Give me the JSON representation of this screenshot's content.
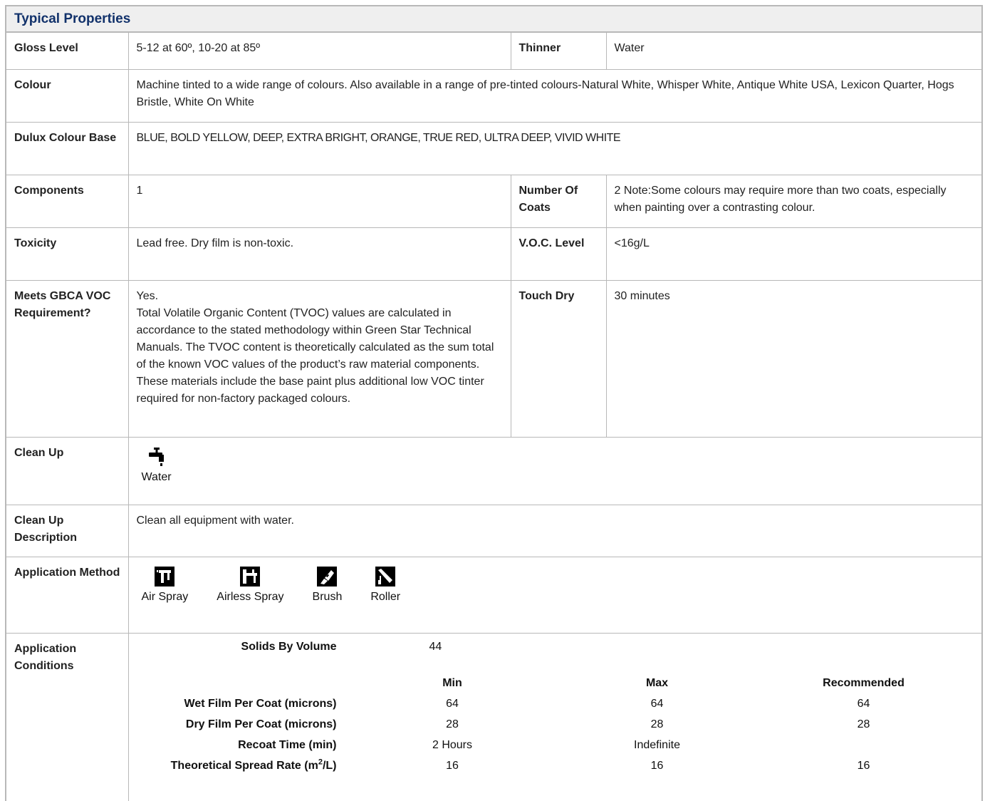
{
  "header": {
    "title": "Typical Properties"
  },
  "rows": {
    "gloss": {
      "label": "Gloss Level",
      "value": "5-12 at 60º, 10-20 at 85º"
    },
    "thinner": {
      "label": "Thinner",
      "value": "Water"
    },
    "colour": {
      "label": "Colour",
      "value": "Machine tinted to a wide range of colours. Also available in a range of pre-tinted colours-Natural White, Whisper White, Antique White USA, Lexicon Quarter, Hogs Bristle, White On White"
    },
    "base": {
      "label": "Dulux Colour Base",
      "value": "BLUE, BOLD YELLOW, DEEP, EXTRA BRIGHT, ORANGE, TRUE RED, ULTRA DEEP, VIVID WHITE"
    },
    "components": {
      "label": "Components",
      "value": "1"
    },
    "coats": {
      "label": "Number Of Coats",
      "value": "2 Note:Some colours may require more than two coats, especially when painting over a contrasting colour."
    },
    "toxicity": {
      "label": "Toxicity",
      "value": "Lead free. Dry film is non-toxic."
    },
    "voc": {
      "label": "V.O.C. Level",
      "value": "<16g/L"
    },
    "gbca": {
      "label": "Meets GBCA VOC Requirement?",
      "value_line1": "Yes.",
      "value_line2": "Total Volatile Organic Content (TVOC) values are calculated in accordance to the stated methodology within Green Star Technical Manuals. The TVOC content is theoretically calculated as the sum total of the known VOC values of the product’s raw material components. These materials include the base paint plus additional low VOC tinter required for non-factory packaged colours."
    },
    "touch": {
      "label": "Touch Dry",
      "value": "30 minutes"
    },
    "cleanup": {
      "label": "Clean Up",
      "items": [
        {
          "icon": "tap-icon",
          "label": "Water"
        }
      ]
    },
    "cleanup_desc": {
      "label": "Clean Up Description",
      "value": "Clean all equipment with water."
    },
    "method": {
      "label": "Application Method",
      "items": [
        {
          "icon": "air-spray-icon",
          "label": "Air Spray"
        },
        {
          "icon": "airless-spray-icon",
          "label": "Airless Spray"
        },
        {
          "icon": "brush-icon",
          "label": "Brush"
        },
        {
          "icon": "roller-icon",
          "label": "Roller"
        }
      ]
    },
    "conditions": {
      "label": "Application Conditions"
    }
  },
  "conditions": {
    "solids": {
      "label": "Solids By Volume",
      "value": "44"
    },
    "headers": {
      "min": "Min",
      "max": "Max",
      "rec": "Recommended"
    },
    "rows": [
      {
        "label": "Wet Film Per Coat (microns)",
        "min": "64",
        "max": "64",
        "rec": "64"
      },
      {
        "label": "Dry Film Per Coat (microns)",
        "min": "28",
        "max": "28",
        "rec": "28"
      },
      {
        "label": "Recoat Time (min)",
        "min": "2 Hours",
        "max": "Indefinite",
        "rec": ""
      },
      {
        "label_pre": "Theoretical Spread Rate (m",
        "label_sup": "2",
        "label_post": "/L)",
        "min": "16",
        "max": "16",
        "rec": "16"
      }
    ]
  }
}
